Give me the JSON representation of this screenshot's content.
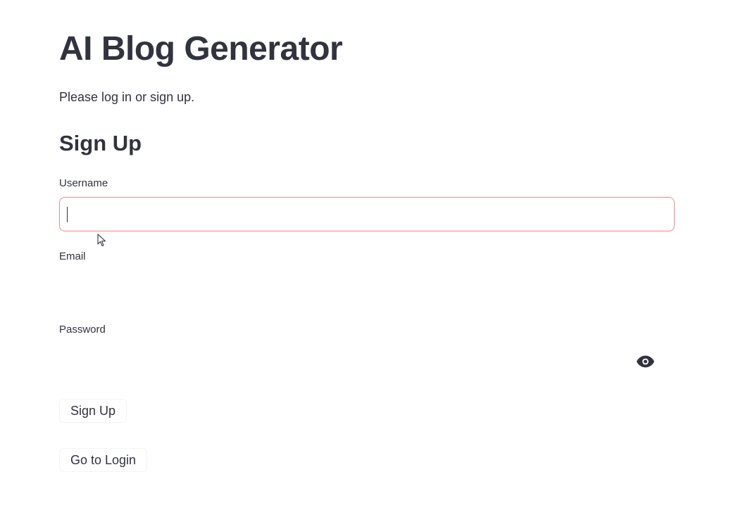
{
  "app": {
    "title": "AI Blog Generator",
    "subtitle": "Please log in or sign up."
  },
  "signup": {
    "heading": "Sign Up",
    "username_label": "Username",
    "username_value": "",
    "email_label": "Email",
    "email_value": "",
    "password_label": "Password",
    "password_value": "",
    "show_password_icon": "eye-icon",
    "signup_button": "Sign Up",
    "goto_login_button": "Go to Login"
  },
  "colors": {
    "text": "#31333f",
    "focused_border": "#f08a8f",
    "background": "#ffffff"
  }
}
